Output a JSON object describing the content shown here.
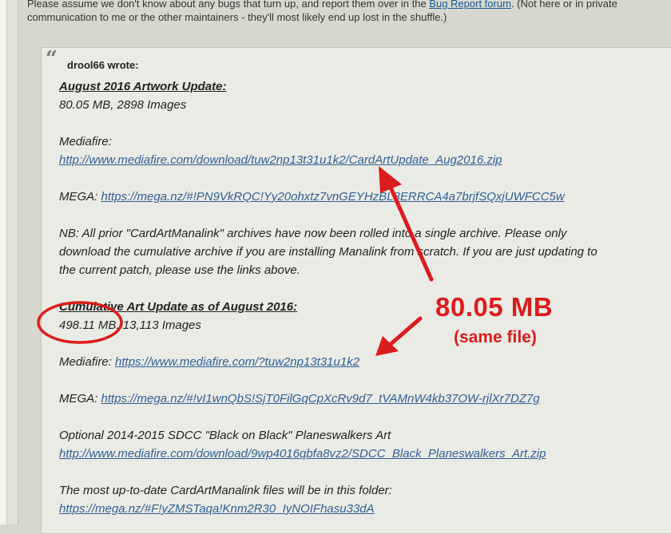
{
  "intro": {
    "line1_prefix": "Please assume we don't know about any bugs that turn up, and report them over in the ",
    "forum_link": "Bug Report forum",
    "line1_suffix": ". (Not here or in private",
    "line2": "communication to me or the other maintainers - they'll most likely end up lost in the shuffle.)"
  },
  "quote": {
    "author": "drool66 wrote:",
    "section1": {
      "heading": "August 2016 Artwork Update:",
      "info": "80.05 MB, 2898 Images",
      "mediafire_label": "Mediafire:",
      "mediafire_url": "http://www.mediafire.com/download/tuw2np13t31u1k2/CardArtUpdate_Aug2016.zip",
      "mega_label": "MEGA: ",
      "mega_url": "https://mega.nz/#!PN9VkRQC!Yy20ohxtz7vnGEYHzBL8ERRCA4a7brjfSQxjUWFCC5w"
    },
    "nb_lines": [
      "NB: All prior \"CardArtManalink\" archives have now been rolled into a single archive. Please only",
      "download the cumulative archive if you are installing Manalink from scratch. If you are just updating to",
      "the current patch, please use the links above."
    ],
    "section2": {
      "heading": "Cumulative Art Update as of August 2016:",
      "info": "498.11 MB, 13,113 Images",
      "mediafire_label": "Mediafire: ",
      "mediafire_url": "https://www.mediafire.com/?tuw2np13t31u1k2",
      "mega_label": "MEGA: ",
      "mega_url": "https://mega.nz/#!vI1wnQbS!SjT0FilGqCpXcRv9d7_tVAMnW4kb37OW-rjlXr7DZ7g"
    },
    "optional": {
      "text": "Optional 2014-2015 SDCC \"Black on Black\" Planeswalkers Art",
      "url": "http://www.mediafire.com/download/9wp4016qbfa8vz2/SDCC_Black_Planeswalkers_Art.zip"
    },
    "folder": {
      "text": "The most up-to-date CardArtManalink files will be in this folder:",
      "url": "https://mega.nz/#F!yZMSTaqa!Knm2R30_IyNOIFhasu33dA"
    }
  },
  "annotation": {
    "big_text": "80.05 MB",
    "small_text": "(same file)",
    "color": "#dc1c1c"
  },
  "colors": {
    "page_bg": "#d7d8cd",
    "quote_bg": "#ebebe5",
    "link": "#2f5f99"
  }
}
